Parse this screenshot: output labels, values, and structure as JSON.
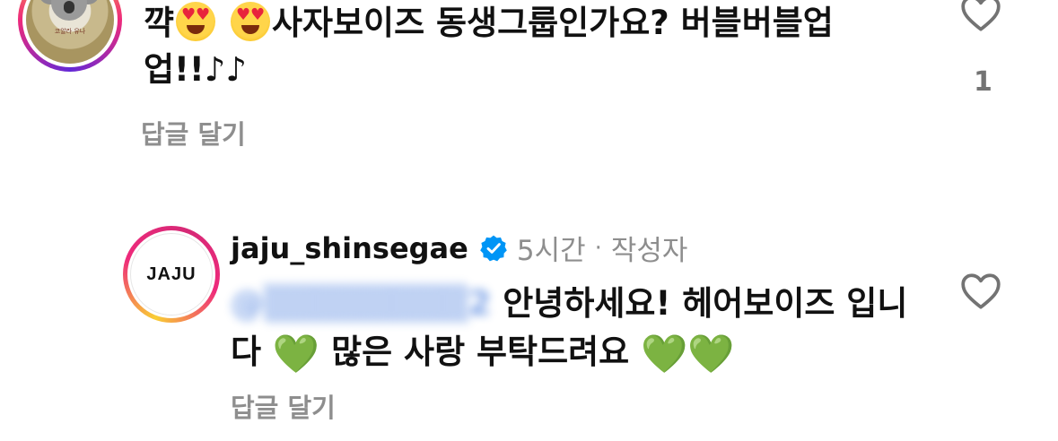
{
  "comment1": {
    "text_prefix": "꺅",
    "text_main": "사자보이즈 동생그룹인가요? 버블버블업",
    "text_line2": "업!!",
    "music_notes": "♪♪",
    "emoji_name": "heart-eyes-face",
    "reply_label": "답글 달기",
    "like_count": "1",
    "avatar_caption": "코알라 유나"
  },
  "comment2": {
    "avatar_text": "JAJU",
    "username": "jaju_shinsegae",
    "time": "5시간",
    "separator": "·",
    "author_badge": "작성자",
    "mention": "@▒▒▒▒▒▒▒▒2",
    "text_line1": " 안녕하세요! 헤어보이즈 입니",
    "text_line2_a": "다 ",
    "green_heart": "💚",
    "text_line2_b": " 많은 사랑 부탁드려요 ",
    "reply_label": "답글 달기"
  },
  "colors": {
    "secondary_text": "#8e8e8e",
    "mention_blue": "#2d6ad8",
    "verified_blue": "#0095f6",
    "green_heart": "#3fb53a"
  }
}
